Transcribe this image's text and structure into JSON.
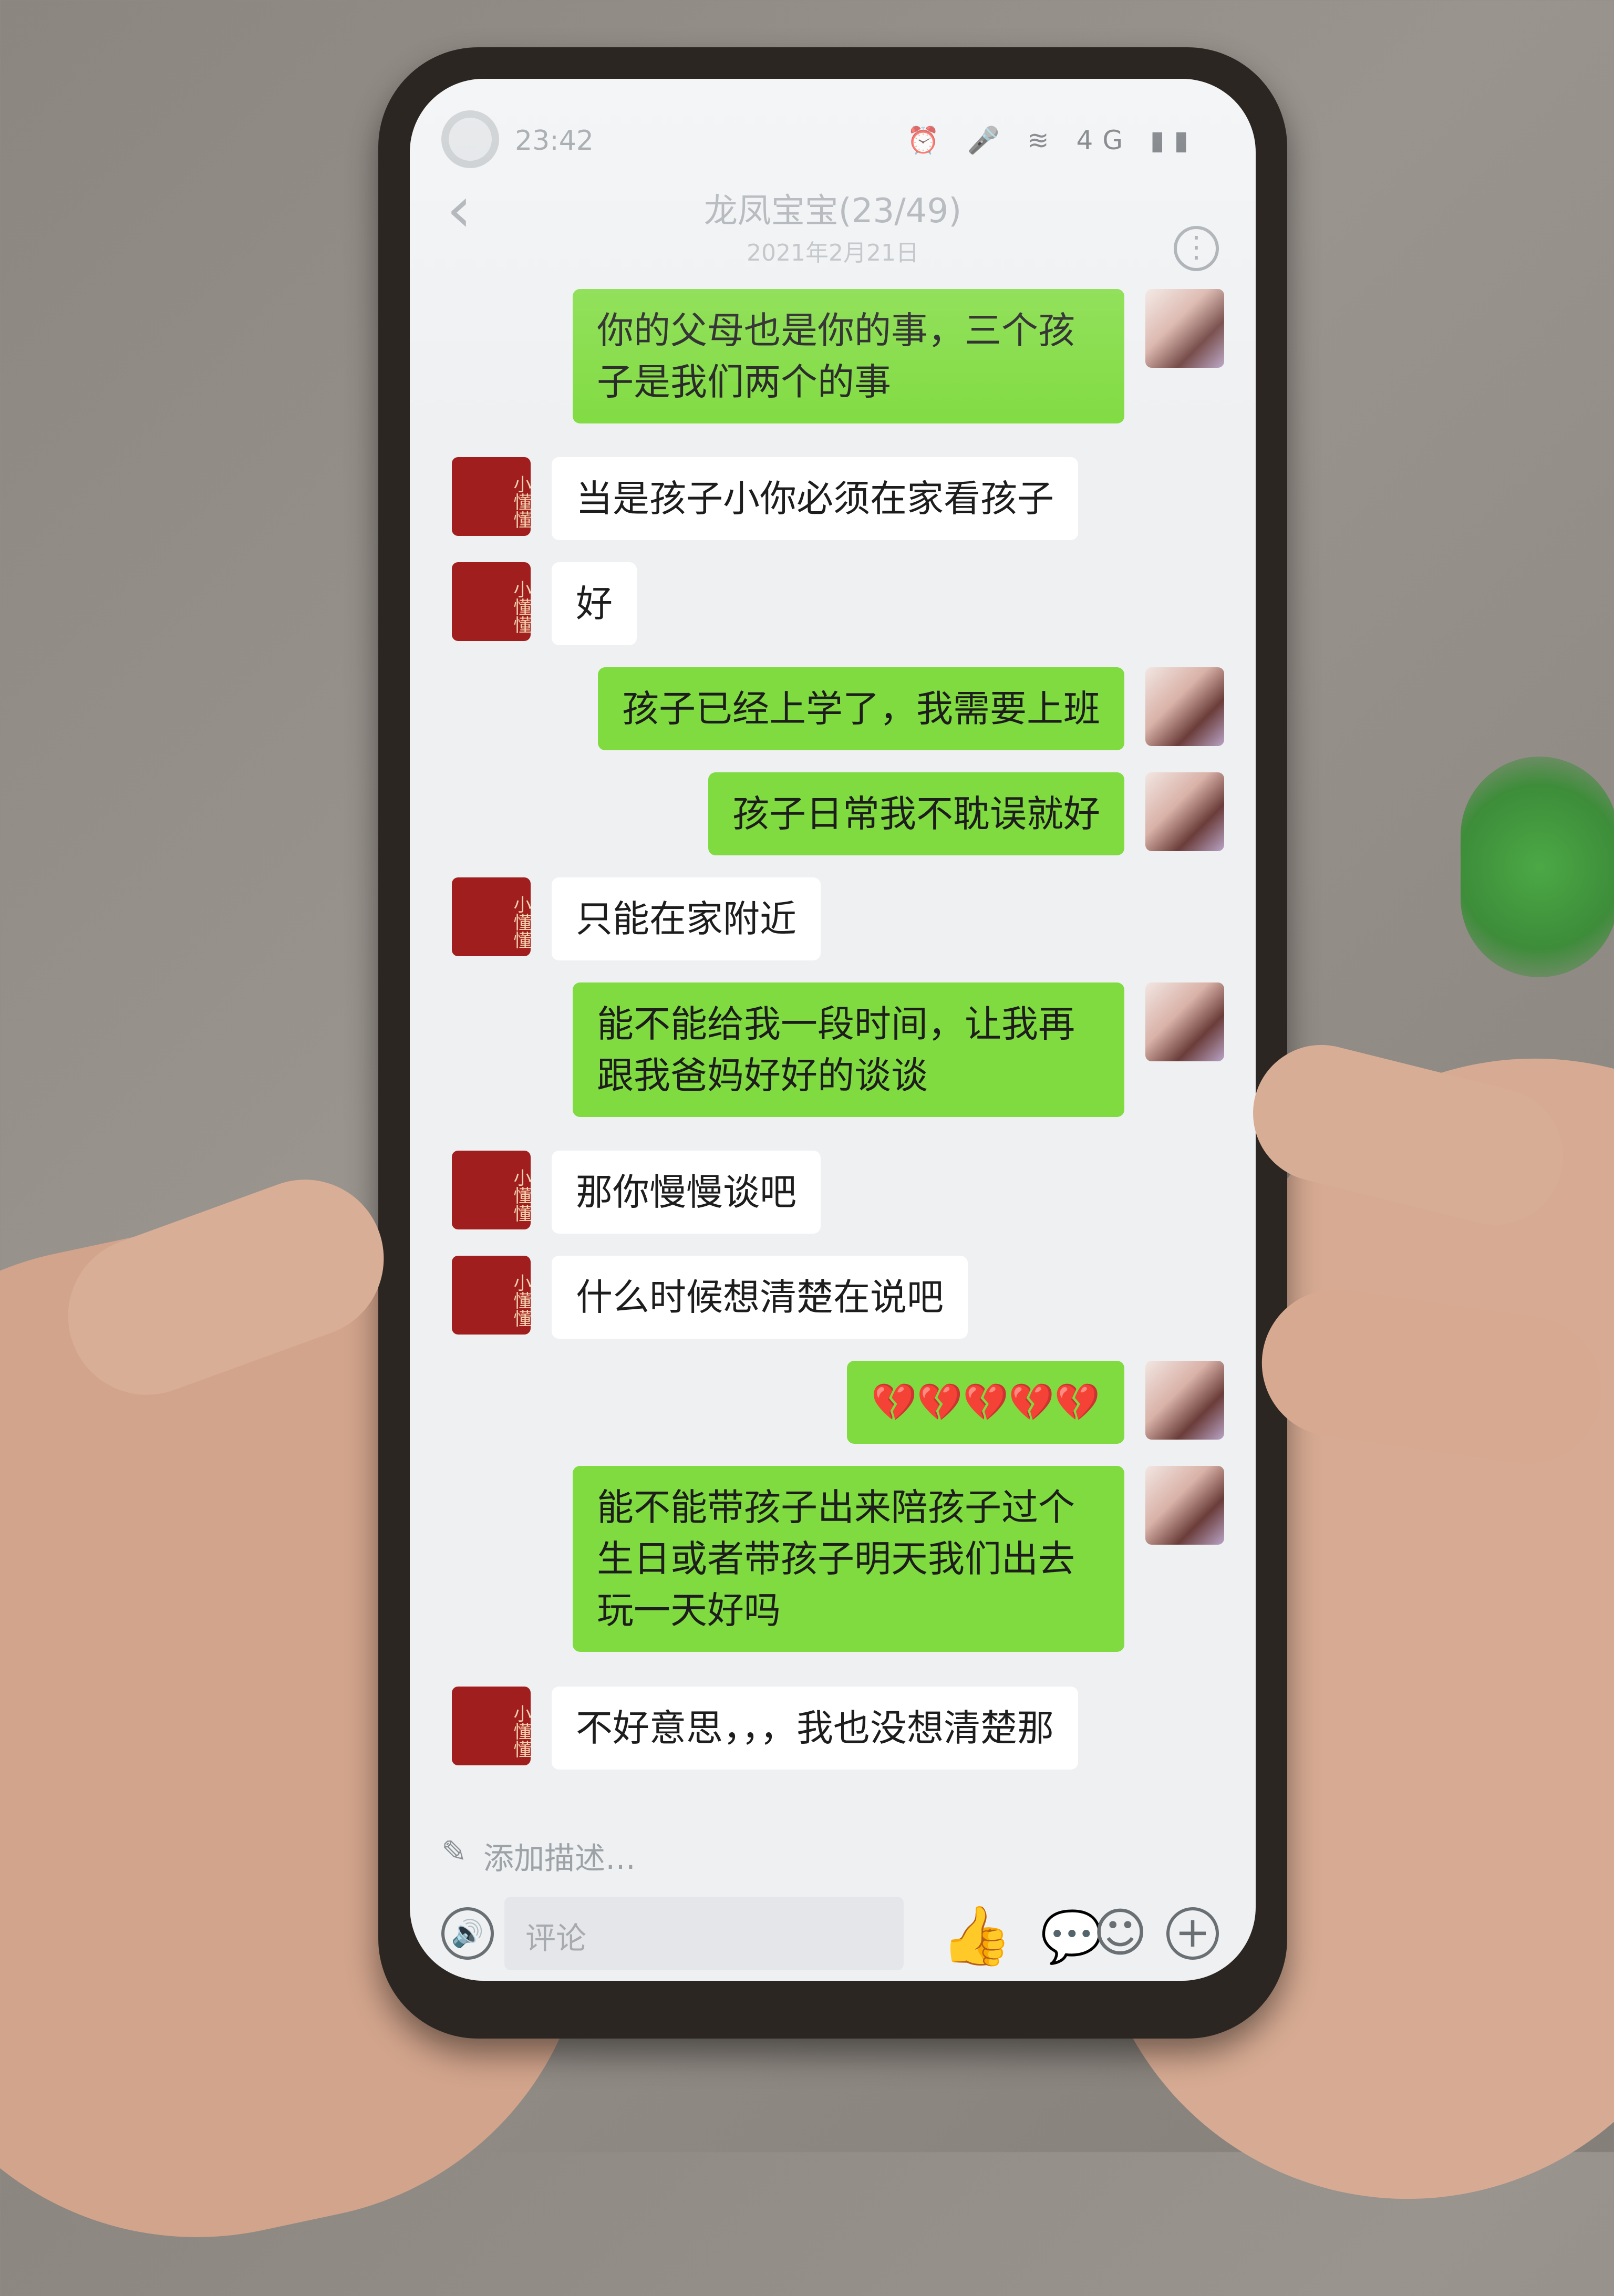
{
  "status_bar": {
    "time": "23:42",
    "icons": "⏰ 🎤 ≋ 4G ▮▮"
  },
  "header": {
    "back_icon": "‹",
    "title": "龙凤宝宝(23/49)",
    "date": "2021年2月21日",
    "more_icon": "⋮"
  },
  "avatars": {
    "other_text": "小懂懂"
  },
  "messages": [
    {
      "sender": "me",
      "text": "你的父母也是你的事，三个孩子是我们两个的事"
    },
    {
      "sender": "other",
      "text": "当是孩子小你必须在家看孩子"
    },
    {
      "sender": "other",
      "text": "好"
    },
    {
      "sender": "me",
      "text": "孩子已经上学了，我需要上班"
    },
    {
      "sender": "me",
      "text": "孩子日常我不耽误就好"
    },
    {
      "sender": "other",
      "text": "只能在家附近"
    },
    {
      "sender": "me",
      "text": "能不能给我一段时间，让我再跟我爸妈好好的谈谈"
    },
    {
      "sender": "other",
      "text": "那你慢慢谈吧"
    },
    {
      "sender": "other",
      "text": "什么时候想清楚在说吧"
    },
    {
      "sender": "me",
      "text": "💔💔💔💔💔"
    },
    {
      "sender": "me",
      "text": "能不能带孩子出来陪孩子过个生日或者带孩子明天我们出去玩一天好吗"
    },
    {
      "sender": "other",
      "text": "不好意思，，，我也没想清楚那"
    }
  ],
  "caption": {
    "placeholder": "添加描述…",
    "icon": "✎"
  },
  "bottom_bar": {
    "voice_icon": "🔊",
    "comment_placeholder": "评论",
    "like_icon": "👍",
    "comment_icon": "💬",
    "emoji_icon": "☺",
    "plus_icon": "+"
  }
}
